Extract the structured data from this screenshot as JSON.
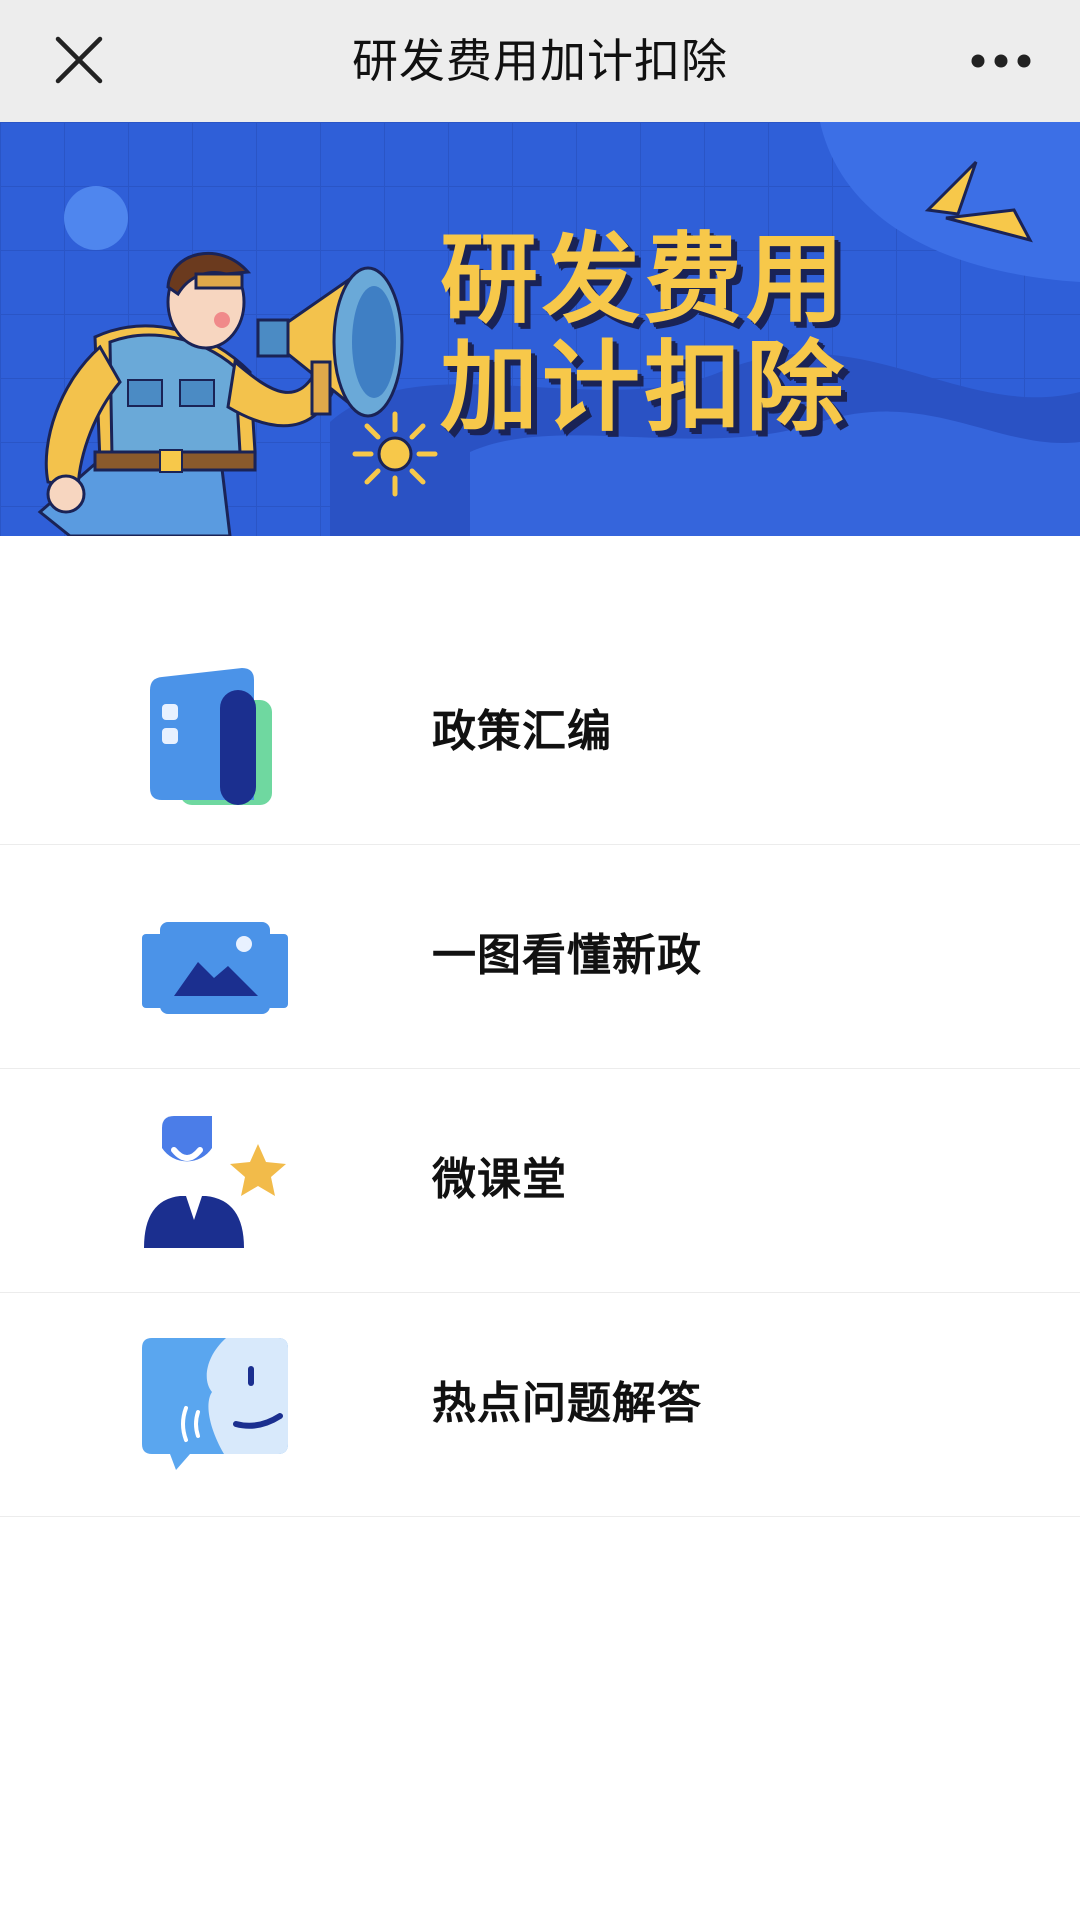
{
  "navbar": {
    "title": "研发费用加计扣除",
    "close_icon": "close-icon",
    "more_icon": "more-horizontal-icon"
  },
  "banner": {
    "title_line1": "研发费用",
    "title_line2": "加计扣除",
    "slide_count": 3,
    "active_slide": 1,
    "colors": {
      "background": "#2f5fd8",
      "title": "#f7c84a",
      "title_shadow": "#1a2356"
    }
  },
  "menu": {
    "items": [
      {
        "label": "政策汇编",
        "icon": "policy-book-icon"
      },
      {
        "label": "一图看懂新政",
        "icon": "image-gallery-icon"
      },
      {
        "label": "微课堂",
        "icon": "lecturer-star-icon"
      },
      {
        "label": "热点问题解答",
        "icon": "face-chat-icon"
      }
    ]
  }
}
